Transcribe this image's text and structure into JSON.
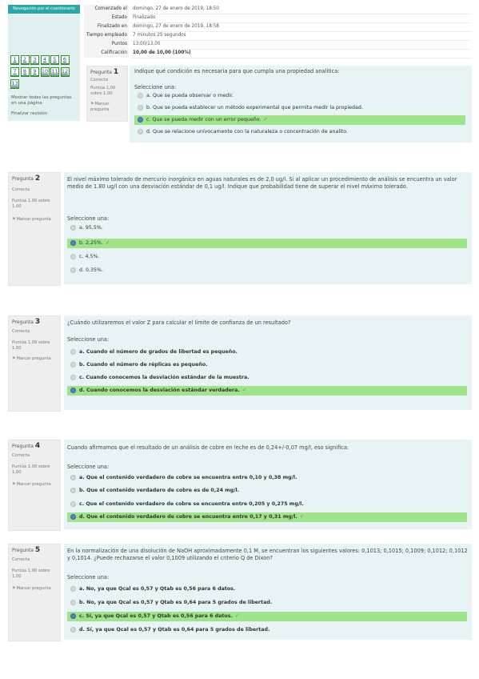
{
  "nav": {
    "title": "Navegación por el cuestionario",
    "questions": [
      "1",
      "2",
      "3",
      "4",
      "5",
      "6",
      "7",
      "8",
      "9",
      "10",
      "11",
      "12",
      "13"
    ],
    "show_one_page": "Mostrar todas las preguntas en una página",
    "finish_review": "Finalizar revisión"
  },
  "summary": [
    {
      "label": "Comenzado el",
      "value": "domingo, 27 de enero de 2019, 18:50"
    },
    {
      "label": "Estado",
      "value": "Finalizado"
    },
    {
      "label": "Finalizado en",
      "value": "domingo, 27 de enero de 2019, 18:58"
    },
    {
      "label": "Tiempo empleado",
      "value": "7 minutos 25 segundos"
    },
    {
      "label": "Puntos",
      "value": "13,00/13,00"
    },
    {
      "label": "Calificación",
      "value": "10,00 de 10,00 (100%)"
    }
  ],
  "labels": {
    "flag": "Marcar pregunta",
    "select_one": "Seleccione una:"
  },
  "questions": [
    {
      "number": "1",
      "prefix": "Pregunta",
      "state": "Correcta",
      "grade": "Puntúa 1,00 sobre 1,00",
      "text": "Indique qué condición es necesaria para que cumpla una propiedad analítica:",
      "options": [
        {
          "text": "a. Que se pueda observar o medir.",
          "selected": false,
          "correct": false
        },
        {
          "text": "b. Que se pueda establecer un método experimental que permita medir la propiedad.",
          "selected": false,
          "correct": false
        },
        {
          "text": "c. Que se pueda medir con un error pequeño.",
          "selected": true,
          "correct": true
        },
        {
          "text": "d. Que se relacione unívocamente con la naturaleza o concentración de analito.",
          "selected": false,
          "correct": false
        }
      ]
    },
    {
      "number": "2",
      "prefix": "Pregunta",
      "state": "Correcta",
      "grade": "Puntúa 1,00 sobre 1,00",
      "text": "El nivel máximo tolerado de mercurio inorgánico en aguas naturales es de 2,0 ug/l. Si al aplicar un procedimiento de análisis se encuentra un valor medio de 1.80 ug/l con una desviación estándar de 0,1 ug/l. Indique que probabilidad tiene de superar el nivel máximo tolerado.",
      "options": [
        {
          "text": "a. 95,5%.",
          "selected": false,
          "correct": false
        },
        {
          "text": "b. 2,25%.",
          "selected": true,
          "correct": true
        },
        {
          "text": "c. 4,5%.",
          "selected": false,
          "correct": false
        },
        {
          "text": "d. 0,35%.",
          "selected": false,
          "correct": false
        }
      ]
    },
    {
      "number": "3",
      "prefix": "Pregunta",
      "state": "Correcta",
      "grade": "Puntúa 1,00 sobre 1,00",
      "text": "¿Cuándo utilizaremos el valor Z para calcular el límite de confianza de un resultado?",
      "options": [
        {
          "text": "a. Cuando el número de grados de libertad es pequeño.",
          "selected": false,
          "correct": false
        },
        {
          "text": "b. Cuando el número de réplicas es pequeño.",
          "selected": false,
          "correct": false
        },
        {
          "text": "c. Cuando conocemos la desviación estándar de la muestra.",
          "selected": false,
          "correct": false
        },
        {
          "text": "d. Cuando conocemos la desviación estándar verdadera.",
          "selected": true,
          "correct": true
        }
      ]
    },
    {
      "number": "4",
      "prefix": "Pregunta",
      "state": "Correcta",
      "grade": "Puntúa 1,00 sobre 1,00",
      "text": "Cuando afirmamos que el resultado de un análisis de cobre en leche es de 0,24+/-0,07 mg/l, eso significa:",
      "options": [
        {
          "text": "a. Que el contenido verdadero de cobre se encuentra entre 0,10 y 0,38 mg/l.",
          "selected": false,
          "correct": false
        },
        {
          "text": "b. Que el contenido verdadero de cobre es de 0,24 mg/l.",
          "selected": false,
          "correct": false
        },
        {
          "text": "c. Que el contenido verdadero de cobre se encuentra entre 0,205 y 0,275 mg/l.",
          "selected": false,
          "correct": false
        },
        {
          "text": "d. Que el contenido verdadero de cobre se encuentra entre 0,17 y 0,31 mg/l.",
          "selected": true,
          "correct": true
        }
      ]
    },
    {
      "number": "5",
      "prefix": "Pregunta",
      "state": "Correcta",
      "grade": "Puntúa 1,00 sobre 1,00",
      "text": "En la normalización de una disolución de NaOH aproximadamente 0,1 M, se encuentran los siguientes valores: 0,1013; 0,1015; 0,1009; 0,1012; 0,1012 y 0,1014. ¿Puede rechazarse el valor 0,1009 utilizando el criterio Q de Dixon?",
      "options": [
        {
          "text": "a. No, ya que Qcal es 0,57 y Qtab es 0,56 para 6 datos.",
          "selected": false,
          "correct": false
        },
        {
          "text": "b. No, ya que Qcal es 0,57 y Qtab es 0,64 para 5 grados de libertad.",
          "selected": false,
          "correct": false
        },
        {
          "text": "c. Sí, ya que Qcal es 0,57 y Qtab es 0,56 para 6 datos.",
          "selected": true,
          "correct": true
        },
        {
          "text": "d. Sí, ya que Qcal es 0,57 y Qtab es 0,64 para 5 grados de libertad.",
          "selected": false,
          "correct": false
        }
      ]
    }
  ]
}
